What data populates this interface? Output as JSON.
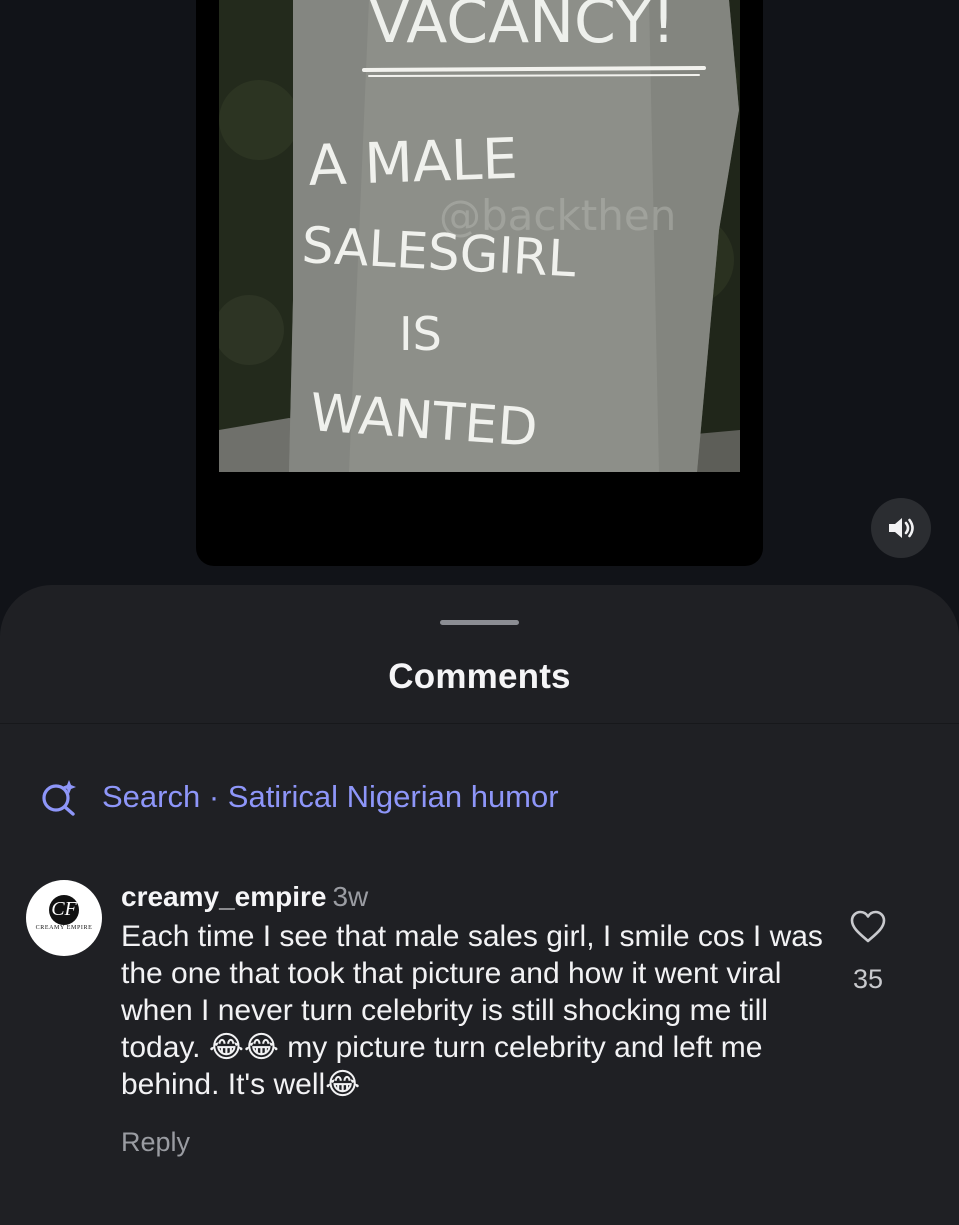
{
  "media": {
    "image_text": {
      "top": "VACANCY!",
      "line1": "A MALE",
      "line2": "SALESGIRL",
      "line3": "IS",
      "line4": "WANTED"
    },
    "watermark": "@backthen",
    "volume_icon": "speaker-icon"
  },
  "comments_sheet": {
    "title": "Comments",
    "search": {
      "icon": "sparkle-search-icon",
      "label": "Search · Satirical Nigerian humor"
    },
    "comments": [
      {
        "avatar": {
          "initials": "CF",
          "name": "CREAMY EMPIRE"
        },
        "username": "creamy_empire",
        "time": "3w",
        "text_part1": "Each time I see that male sales girl, I smile cos I was the one that took that picture and how it went viral when I never turn celebrity is still shocking me till today. ",
        "emoji_a": "😂😂",
        "text_part2": " my picture turn celebrity and left me behind. It's well",
        "emoji_b": "😂",
        "reply_label": "Reply",
        "like_icon": "heart-outline-icon",
        "like_count": "35"
      }
    ]
  },
  "colors": {
    "background": "#111318",
    "sheet": "#1f2024",
    "search_accent": "#8e96f9",
    "secondary_text": "#9a9ca2"
  }
}
